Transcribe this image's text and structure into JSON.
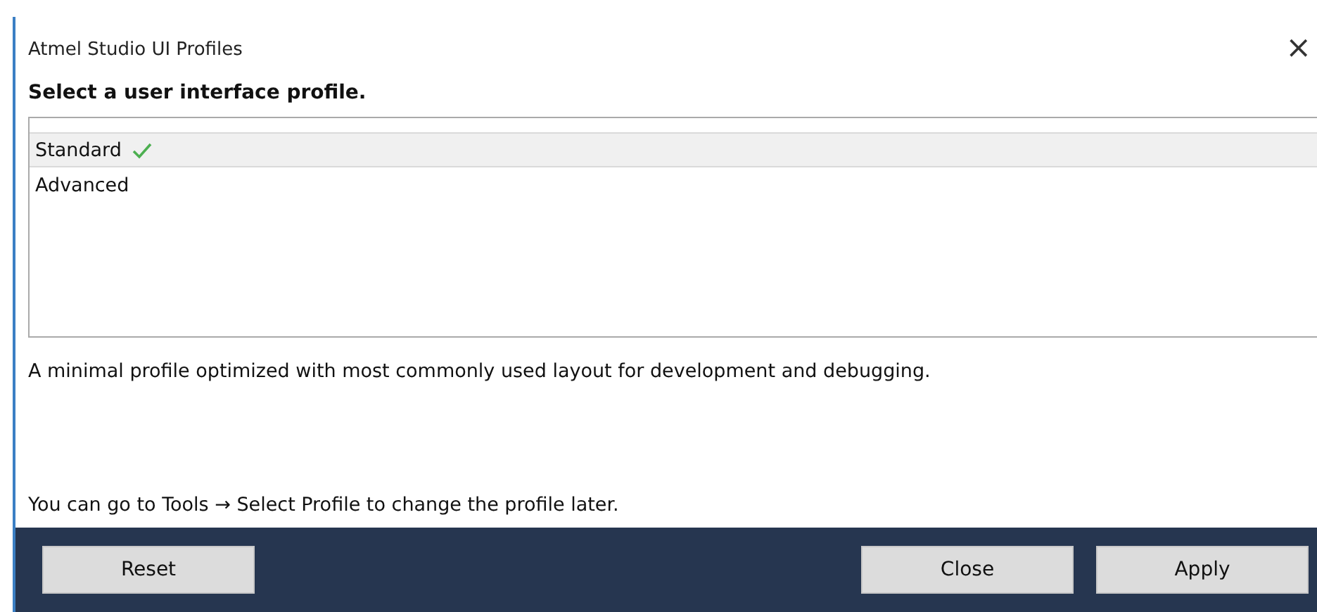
{
  "window": {
    "title": "Atmel Studio UI Profiles",
    "close": "×"
  },
  "heading": "Select a user interface profile.",
  "profiles": [
    {
      "label": "Standard",
      "selected": true
    },
    {
      "label": "Advanced",
      "selected": false
    }
  ],
  "description": "A minimal profile optimized with most commonly used layout for development and debugging.",
  "hint": "You can go to Tools → Select Profile to change the profile later.",
  "buttons": {
    "left": [
      "Reset"
    ],
    "right": [
      "Close",
      "Apply"
    ]
  }
}
